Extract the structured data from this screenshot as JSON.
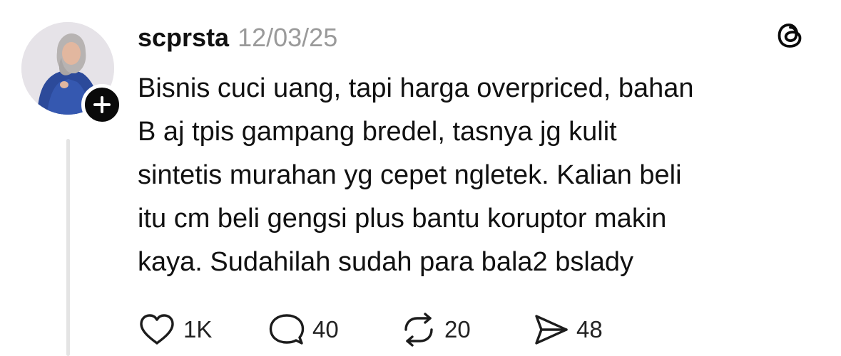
{
  "post": {
    "username": "scprsta",
    "timestamp": "12/03/25",
    "text": "Bisnis cuci uang, tapi harga overpriced, bahan\nB aj tpis gampang bredel, tasnya jg kulit\nsintetis murahan yg cepet ngletek. Kalian beli\nitu cm beli gengsi plus bantu koruptor makin\nkaya. Sudahilah sudah para bala2 bslady"
  },
  "actions": {
    "likes": "1K",
    "replies": "40",
    "reposts": "20",
    "shares": "48"
  },
  "icons": {
    "avatar": "avatar",
    "follow": "plus-icon",
    "logo": "threads-logo-icon",
    "like": "heart-icon",
    "reply": "speech-bubble-icon",
    "repost": "repost-arrows-icon",
    "share": "send-icon"
  },
  "colors": {
    "text": "#111111",
    "muted": "#9a9a9a",
    "thread_line": "#e4e4e4",
    "badge": "#0a0a0a"
  }
}
